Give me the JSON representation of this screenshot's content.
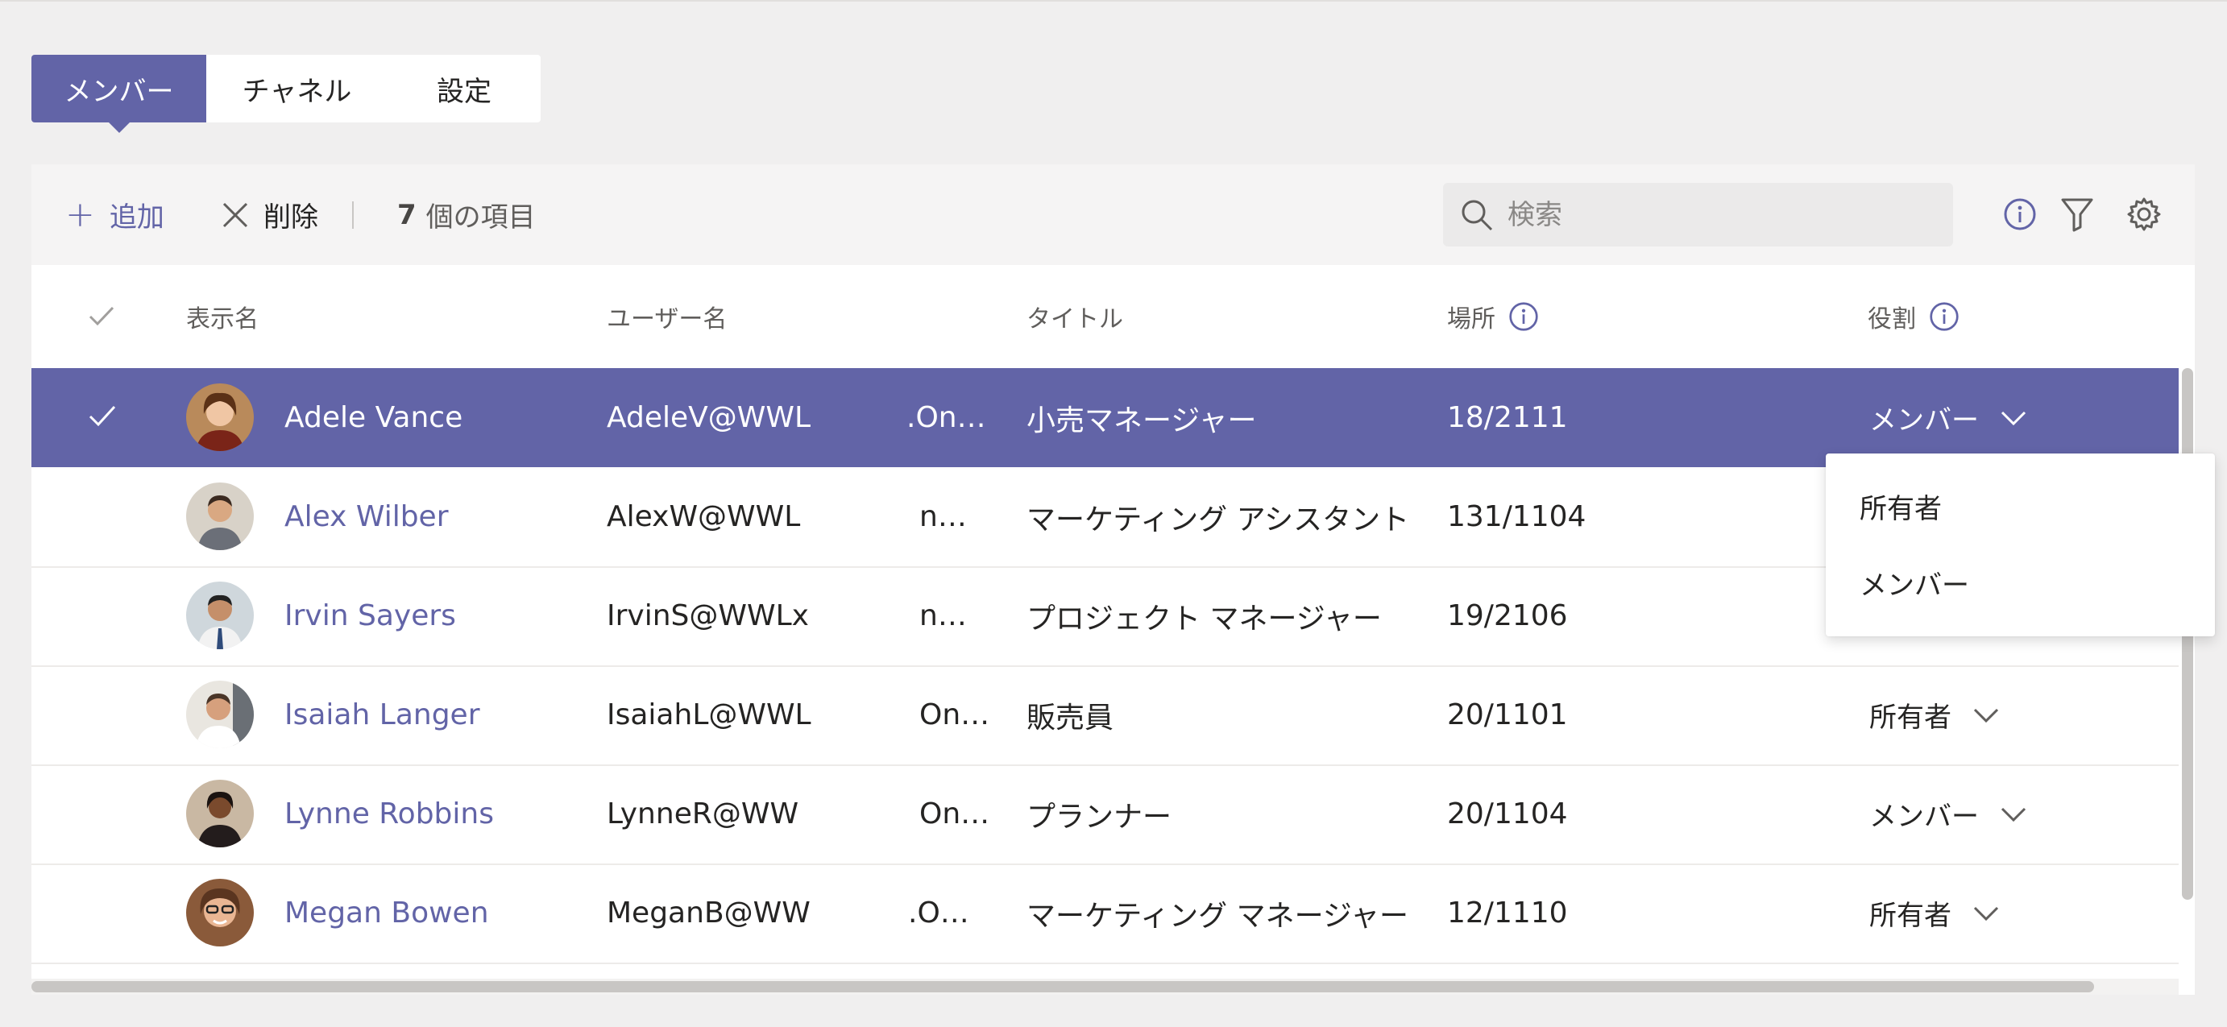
{
  "tabs": [
    {
      "label": "メンバー",
      "active": true
    },
    {
      "label": "チャネル",
      "active": false
    },
    {
      "label": "設定",
      "active": false
    }
  ],
  "toolbar": {
    "add_label": "追加",
    "delete_label": "削除",
    "count_number": "7",
    "count_suffix": "個の項目",
    "search_placeholder": "検索"
  },
  "columns": {
    "display_name": "表示名",
    "user_name": "ユーザー名",
    "title": "タイトル",
    "location": "場所",
    "role": "役割"
  },
  "rows": [
    {
      "name": "Adele Vance",
      "user_a": "AdeleV@WWL",
      "user_b": ".On…",
      "title": "小売マネージャー",
      "location": "18/2111",
      "role": "メンバー",
      "selected": true
    },
    {
      "name": "Alex Wilber",
      "user_a": "AlexW@WWL",
      "user_b": "n…",
      "title": "マーケティング アシスタント",
      "location": "131/1104",
      "role": "",
      "selected": false
    },
    {
      "name": "Irvin Sayers",
      "user_a": "IrvinS@WWLx",
      "user_b": "n…",
      "title": "プロジェクト マネージャー",
      "location": "19/2106",
      "role": "",
      "selected": false
    },
    {
      "name": "Isaiah Langer",
      "user_a": "IsaiahL@WWL",
      "user_b": "On…",
      "title": "販売員",
      "location": "20/1101",
      "role": "所有者",
      "selected": false
    },
    {
      "name": "Lynne Robbins",
      "user_a": "LynneR@WW",
      "user_b": "On…",
      "title": "プランナー",
      "location": "20/1104",
      "role": "メンバー",
      "selected": false
    },
    {
      "name": "Megan Bowen",
      "user_a": "MeganB@WW",
      "user_b": ".O…",
      "title": "マーケティング マネージャー",
      "location": "12/1110",
      "role": "所有者",
      "selected": false
    }
  ],
  "role_dropdown": {
    "options": [
      "所有者",
      "メンバー"
    ]
  },
  "colors": {
    "accent": "#6264a7",
    "background": "#f0efef",
    "toolbar": "#f5f4f4"
  }
}
